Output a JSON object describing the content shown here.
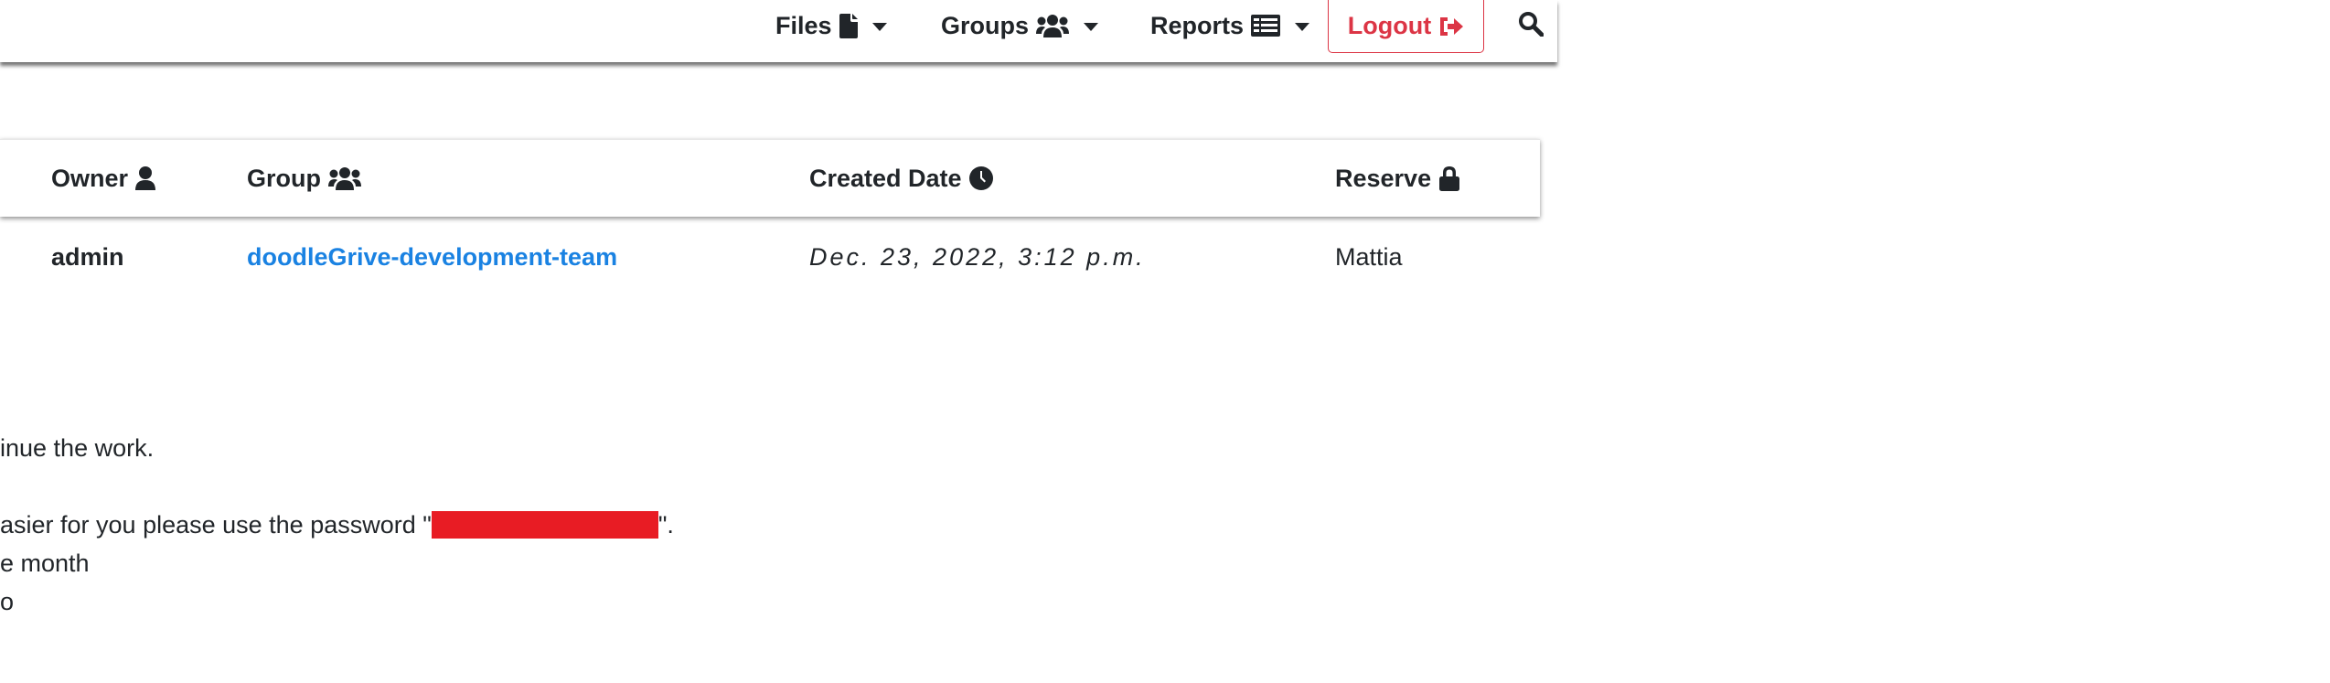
{
  "navbar": {
    "files_label": "Files",
    "groups_label": "Groups",
    "reports_label": "Reports",
    "logout_label": "Logout"
  },
  "table": {
    "headers": {
      "owner": "Owner",
      "group": "Group",
      "created_date": "Created Date",
      "reserve": "Reserve"
    },
    "row": {
      "owner": "admin",
      "group": "doodleGrive-development-team",
      "created_date": "Dec. 23, 2022, 3:12 p.m.",
      "reserve": "Mattia"
    }
  },
  "body": {
    "line1": "inue the work.",
    "line2_before": "asier for you please use the password \"",
    "line2_after": "\".",
    "line3": "e month",
    "line4": "o"
  },
  "colors": {
    "link": "#1a82e2",
    "danger": "#dc3545",
    "redaction": "#e81c24",
    "text": "#212529"
  },
  "icons": [
    "file-icon",
    "users-icon",
    "report-icon",
    "logout-icon",
    "search-icon",
    "user-icon",
    "clock-icon",
    "lock-icon"
  ]
}
